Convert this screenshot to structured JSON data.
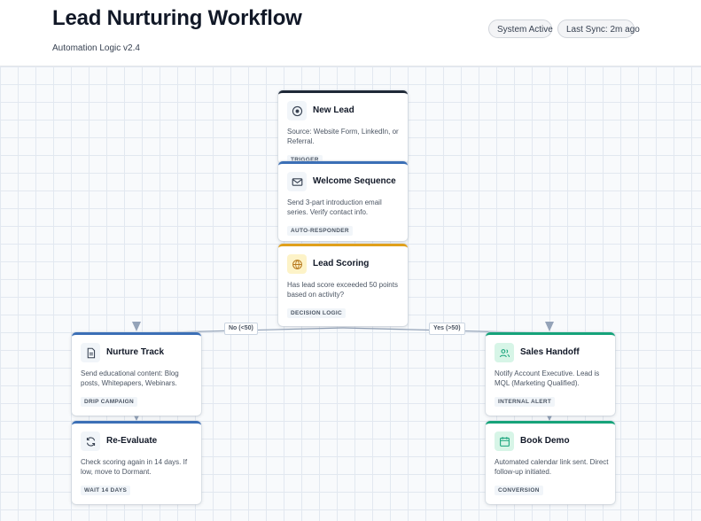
{
  "header": {
    "title": "Lead Nurturing Workflow",
    "subtitle": "Automation Logic v2.4",
    "status_badges": [
      "System Active",
      "Last Sync: 2m ago"
    ]
  },
  "edges": {
    "no_label": "No (<50)",
    "yes_label": "Yes (>50)"
  },
  "nodes": {
    "new_lead": {
      "title": "New Lead",
      "description": "Source: Website Form, LinkedIn, or Referral.",
      "tag": "TRIGGER",
      "icon": "target-icon"
    },
    "welcome_sequence": {
      "title": "Welcome Sequence",
      "description": "Send 3-part introduction email series. Verify contact info.",
      "tag": "AUTO-RESPONDER",
      "icon": "mail-icon"
    },
    "lead_scoring": {
      "title": "Lead Scoring",
      "description": "Has lead score exceeded 50 points based on activity?",
      "tag": "DECISION LOGIC",
      "icon": "globe-icon"
    },
    "nurture_track": {
      "title": "Nurture Track",
      "description": "Send educational content: Blog posts, Whitepapers, Webinars.",
      "tag": "DRIP CAMPAIGN",
      "icon": "document-icon"
    },
    "re_evaluate": {
      "title": "Re-Evaluate",
      "description": "Check scoring again in 14 days. If low, move to Dormant.",
      "tag": "WAIT 14 DAYS",
      "icon": "refresh-icon"
    },
    "sales_handoff": {
      "title": "Sales Handoff",
      "description": "Notify Account Executive. Lead is MQL (Marketing Qualified).",
      "tag": "INTERNAL ALERT",
      "icon": "users-icon"
    },
    "book_demo": {
      "title": "Book Demo",
      "description": "Automated calendar link sent. Direct follow-up initiated.",
      "tag": "CONVERSION",
      "icon": "calendar-icon"
    }
  },
  "colors": {
    "trigger_accent": "#1f2937",
    "process_accent": "#3b6fb6",
    "decision_accent": "#e0a01b",
    "success_accent": "#16a37a"
  }
}
